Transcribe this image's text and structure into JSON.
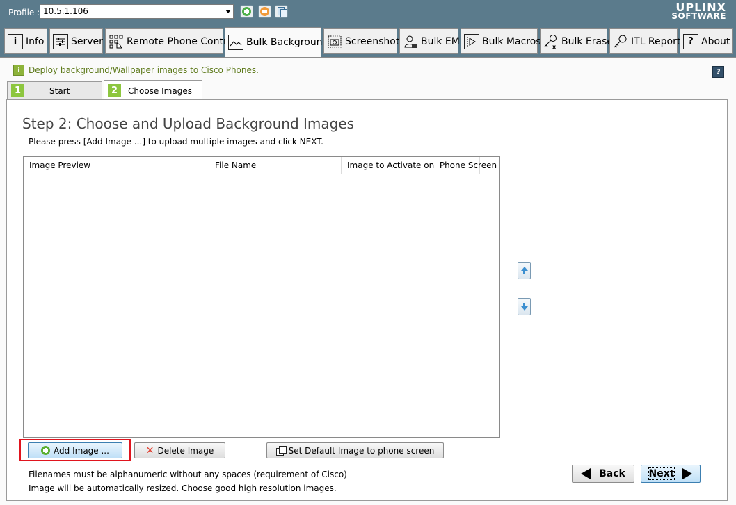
{
  "header": {
    "profile_label": "Profile :",
    "profile_value": "10.5.1.106",
    "logo_line1": "UPLINX",
    "logo_line2": "SOFTWARE",
    "add_profile_color": "#4fb04a",
    "remove_profile_color": "#f09a3a"
  },
  "tabs": [
    {
      "label": "Info",
      "icon": "info-icon"
    },
    {
      "label": "Server",
      "icon": "sliders-icon"
    },
    {
      "label": "Remote Phone Control",
      "icon": "keypad-icon"
    },
    {
      "label": "Bulk Background",
      "icon": "image-icon"
    },
    {
      "label": "Screenshots",
      "icon": "camera-icon"
    },
    {
      "label": "Bulk EM",
      "icon": "user-icon"
    },
    {
      "label": "Bulk Macros",
      "icon": "film-icon"
    },
    {
      "label": "Bulk Erase",
      "icon": "key-erase-icon"
    },
    {
      "label": "ITL Report",
      "icon": "key-icon"
    },
    {
      "label": "About",
      "icon": "question-icon"
    }
  ],
  "info_text": "Deploy background/Wallpaper images to Cisco Phones.",
  "wizard_tabs": [
    {
      "num": "1",
      "label": "Start"
    },
    {
      "num": "2",
      "label": "Choose Images"
    }
  ],
  "step": {
    "title": "Step 2: Choose and Upload Background Images",
    "subtitle": "Please press [Add Image ...] to upload multiple images and click NEXT."
  },
  "grid": {
    "columns": [
      "Image Preview",
      "File Name",
      "Image to Activate on  Phone Screen"
    ],
    "rows": []
  },
  "buttons": {
    "add_image": "Add Image ...",
    "delete_image": "Delete Image",
    "set_default": "Set Default Image to phone screen",
    "back": "Back",
    "next": "Next"
  },
  "notes": [
    "Filenames must be alphanumeric without any spaces (requirement of Cisco)",
    "Image will be automatically resized. Choose good high resolution images."
  ]
}
